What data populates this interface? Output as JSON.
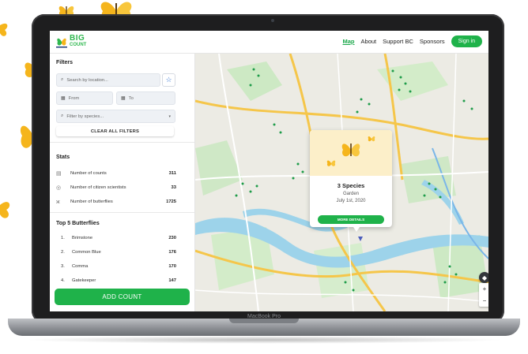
{
  "header": {
    "logo_big": "BIG",
    "logo_count": "COUNT",
    "nav": [
      "Map",
      "About",
      "Support BC",
      "Sponsors"
    ],
    "sign_in": "Sign in"
  },
  "filters": {
    "title": "Filters",
    "search_placeholder": "Search by location...",
    "from_placeholder": "From",
    "to_placeholder": "To",
    "species_placeholder": "Filter by species...",
    "clear_label": "CLEAR ALL FILTERS"
  },
  "stats": {
    "title": "Stats",
    "rows": [
      {
        "label": "Number of counts",
        "value": "311"
      },
      {
        "label": "Number of citizen scientists",
        "value": "33"
      },
      {
        "label": "Number of butterflies",
        "value": "1725"
      }
    ]
  },
  "top5": {
    "title": "Top 5 Butterflies",
    "rows": [
      {
        "rank": "1.",
        "name": "Brimstone",
        "value": "230"
      },
      {
        "rank": "2.",
        "name": "Common Blue",
        "value": "176"
      },
      {
        "rank": "3.",
        "name": "Comma",
        "value": "170"
      },
      {
        "rank": "4.",
        "name": "Gatekeeper",
        "value": "147"
      }
    ]
  },
  "add_count": "ADD COUNT",
  "popup": {
    "title": "3 Species",
    "location": "Garden",
    "date": "July 1st, 2020",
    "button": "MORE DETAILS"
  },
  "device_label": "MacBook Pro",
  "colors": {
    "brand_green": "#1fb24a",
    "popup_header": "#fcefc9",
    "butterfly_yellow": "#f5b51c"
  }
}
